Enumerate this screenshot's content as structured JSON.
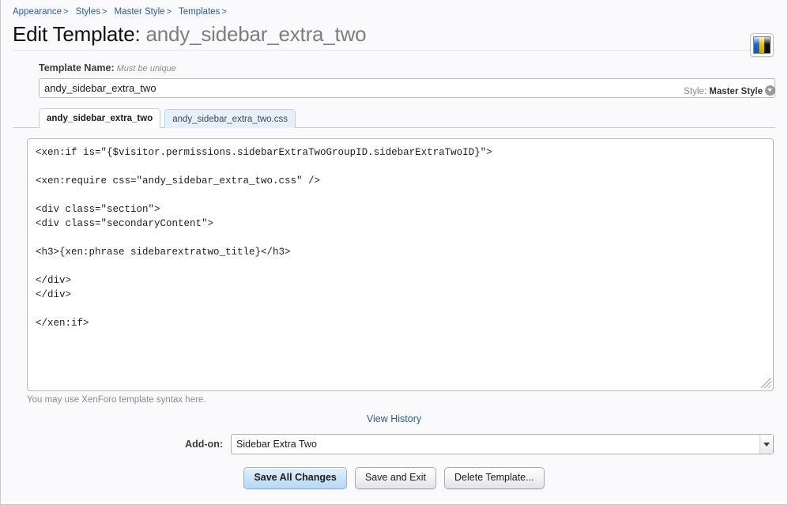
{
  "breadcrumb": {
    "items": [
      {
        "label": "Appearance",
        "sep": ">"
      },
      {
        "label": "Styles",
        "sep": ">"
      },
      {
        "label": "Master Style",
        "sep": ">"
      },
      {
        "label": "Templates",
        "sep": ">"
      }
    ]
  },
  "header": {
    "title_prefix": "Edit Template:",
    "title_name": "andy_sidebar_extra_two",
    "swatch_icon": "style-color-swatch-icon",
    "swatch_colors": [
      "#1268d4",
      "#f2c200",
      "#111111"
    ]
  },
  "form": {
    "name_label": "Template Name:",
    "name_hint": "Must be unique",
    "name_value": "andy_sidebar_extra_two",
    "name_placeholder": "",
    "style_prefix": "Style:",
    "style_value": "Master Style",
    "style_chevron_icon": "chevron-down-circle-icon"
  },
  "tabs": [
    {
      "label": "andy_sidebar_extra_two",
      "active": true
    },
    {
      "label": "andy_sidebar_extra_two.css",
      "active": false
    }
  ],
  "editor": {
    "code": "<xen:if is=\"{$visitor.permissions.sidebarExtraTwoGroupID.sidebarExtraTwoID}\">\n\n<xen:require css=\"andy_sidebar_extra_two.css\" />\n\n<div class=\"section\">\n<div class=\"secondaryContent\">\n\n<h3>{xen:phrase sidebarextratwo_title}</h3>\n\n</div>\n</div>\n\n</xen:if>\n",
    "note": "You may use XenForo template syntax here.",
    "resize_handle_icon": "resize-handle-icon"
  },
  "history": {
    "link_label": "View History"
  },
  "addon": {
    "label": "Add-on:",
    "selected": "Sidebar Extra Two",
    "dropdown_icon": "select-arrow-icon"
  },
  "buttons": [
    {
      "label": "Save All Changes",
      "primary": true
    },
    {
      "label": "Save and Exit",
      "primary": false
    },
    {
      "label": "Delete Template...",
      "primary": false
    }
  ],
  "colors": {
    "link": "#2c5aa0",
    "page_bg": "#fafafc",
    "tab_border": "#b9d2e8",
    "tab_inactive_bg": "#e7f0f9",
    "primary_button": "#cbe3f7"
  }
}
